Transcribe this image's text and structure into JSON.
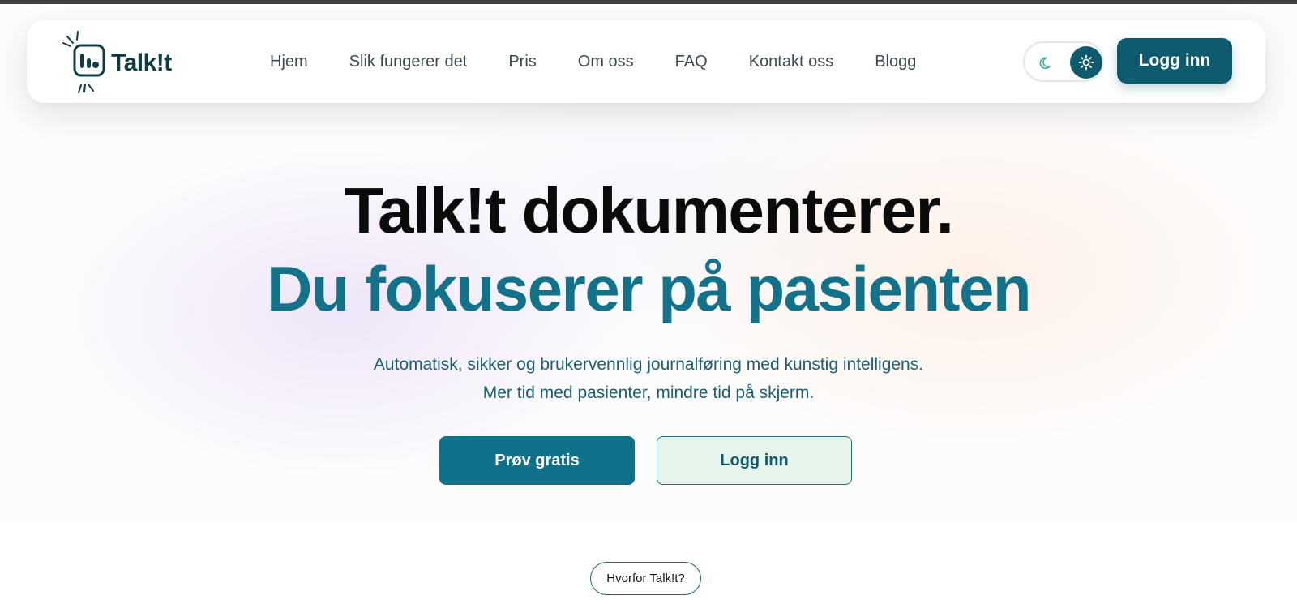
{
  "brand": {
    "logo_text": "Talk!t"
  },
  "nav": {
    "links": [
      {
        "label": "Hjem"
      },
      {
        "label": "Slik fungerer det"
      },
      {
        "label": "Pris"
      },
      {
        "label": "Om oss"
      },
      {
        "label": "FAQ"
      },
      {
        "label": "Kontakt oss"
      },
      {
        "label": "Blogg"
      }
    ],
    "theme_toggle": {
      "left_icon": "moon-icon",
      "right_icon": "sun-icon",
      "selected": "light"
    },
    "login_label": "Logg inn"
  },
  "hero": {
    "headline": "Talk!t dokumenterer.",
    "subheadline": "Du fokuserer på pasienten",
    "description_line1": "Automatisk, sikker og brukervennlig journalføring med kunstig intelligens.",
    "description_line2": "Mer tid med pasienter, mindre tid på skjerm.",
    "primary_button": "Prøv gratis",
    "secondary_button": "Logg inn"
  },
  "section_badge": "Hvorfor Talk!t?",
  "colors": {
    "brand_dark": "#0e5b6f",
    "brand_teal": "#13728a",
    "text_dark": "#0b0b0b",
    "moon_accent": "#3bb39a"
  }
}
